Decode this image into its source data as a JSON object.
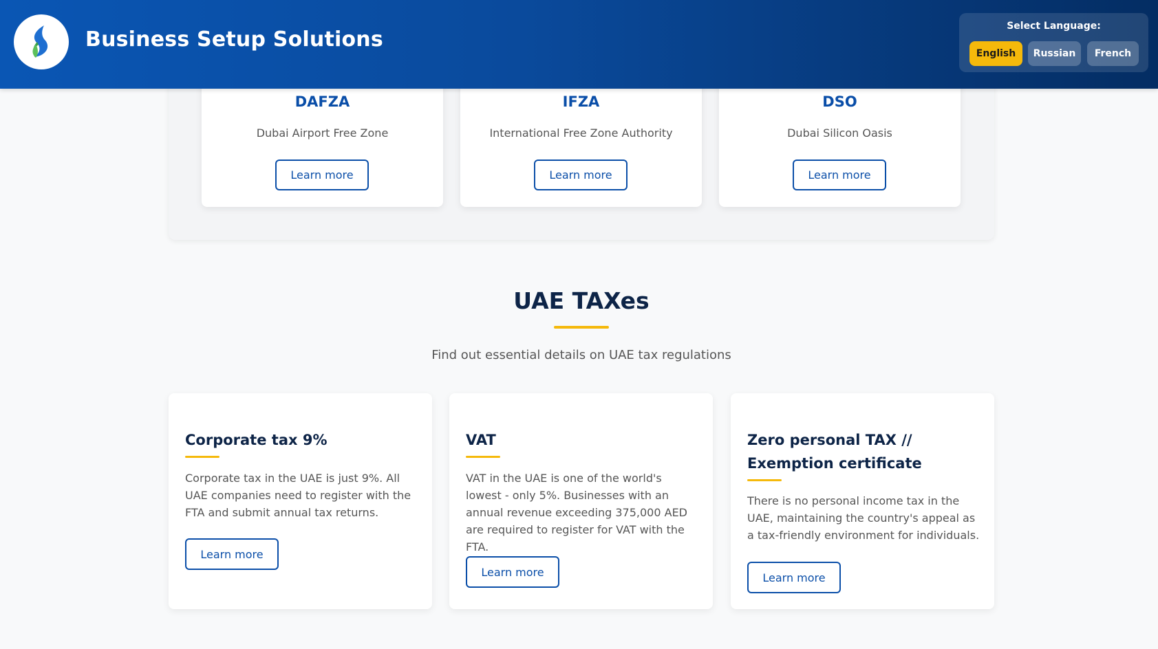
{
  "header": {
    "title": "Business Setup Solutions",
    "logo_icon": "flame-drop-logo-icon",
    "language": {
      "label": "Select Language:",
      "options": [
        "English",
        "Russian",
        "French"
      ],
      "selected": "English"
    }
  },
  "free_zones": [
    {
      "name": "DAFZA",
      "description": "Dubai Airport Free Zone",
      "button": "Learn more"
    },
    {
      "name": "IFZA",
      "description": "International Free Zone Authority",
      "button": "Learn more"
    },
    {
      "name": "DSO",
      "description": "Dubai Silicon Oasis",
      "button": "Learn more"
    }
  ],
  "taxes": {
    "title": "UAE TAXes",
    "subtitle": "Find out essential details on UAE tax regulations",
    "cards": [
      {
        "title": "Corporate tax 9%",
        "description": "Corporate tax in the UAE is just 9%. All UAE companies need to register with the FTA and submit annual tax returns.",
        "button": "Learn more"
      },
      {
        "title": "VAT",
        "description": "VAT in the UAE is one of the world's lowest - only 5%. Businesses with an annual revenue exceeding 375,000 AED are required to register for VAT with the FTA.",
        "button": "Learn more"
      },
      {
        "title": "Zero personal TAX // Exemption certificate",
        "description": "There is no personal income tax in the UAE, maintaining the country's appeal as a tax-friendly environment for individuals.",
        "button": "Learn more"
      }
    ]
  },
  "colors": {
    "primary": "#0a4ea8",
    "accent": "#f5b90b",
    "heading": "#0d2447"
  }
}
